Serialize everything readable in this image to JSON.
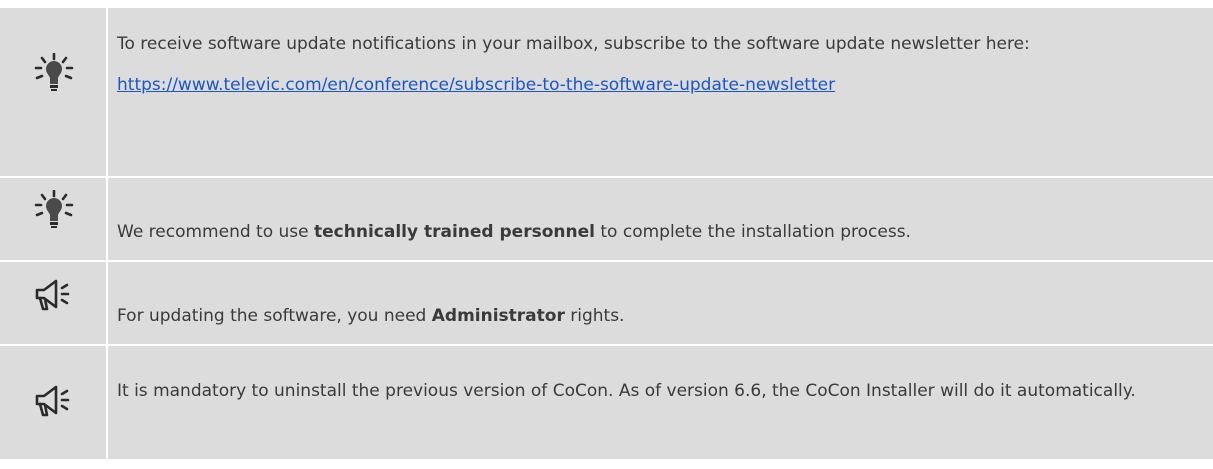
{
  "notes": [
    {
      "icon": "lightbulb-icon",
      "paragraph": "To receive software update notifications in your mailbox, subscribe to the software update newsletter here:",
      "link": "https://www.televic.com/en/conference/subscribe-to-the-software-update-newsletter"
    },
    {
      "icon": "lightbulb-icon",
      "before": "We recommend to use ",
      "bold": "technically trained personnel",
      "after": " to complete the installation process."
    },
    {
      "icon": "megaphone-icon",
      "before": "For updating the software, you need ",
      "bold": "Administrator",
      "after": " rights."
    },
    {
      "icon": "megaphone-icon",
      "text": "It is mandatory to uninstall the previous version of CoCon. As of version 6.6, the CoCon Installer will do it automatically."
    }
  ]
}
